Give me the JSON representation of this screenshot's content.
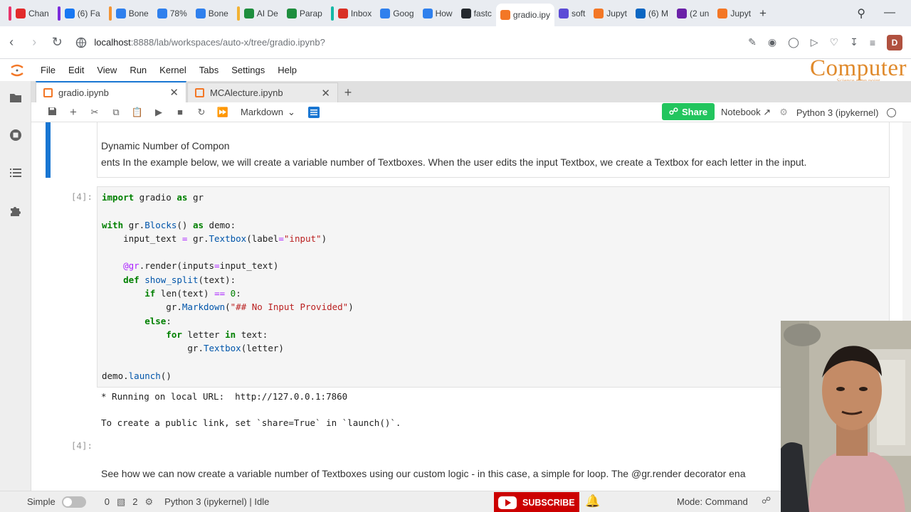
{
  "browser": {
    "tabs": [
      {
        "label": "Chan",
        "color": "#e22b2b",
        "group": "#e8336b"
      },
      {
        "label": "(6) Fa",
        "color": "#1877f2",
        "group": "#7b2cdb"
      },
      {
        "label": "Bone",
        "color": "#2f80ed",
        "group": "#f29433"
      },
      {
        "label": "78%",
        "color": "#2f80ed"
      },
      {
        "label": "Bone",
        "color": "#2f80ed"
      },
      {
        "label": "AI De",
        "color": "#1e8e3e",
        "group": "#f2b233"
      },
      {
        "label": "Parap",
        "color": "#1e8e3e"
      },
      {
        "label": "Inbox",
        "color": "#d93025",
        "group": "#14b8a6"
      },
      {
        "label": "Goog",
        "color": "#2f80ed"
      },
      {
        "label": "How",
        "color": "#2f80ed"
      },
      {
        "label": "fastc",
        "color": "#24292e"
      },
      {
        "label": "gradio.ipy",
        "color": "#f37726",
        "active": true
      },
      {
        "label": "soft",
        "color": "#5b4bd6"
      },
      {
        "label": "Jupyt",
        "color": "#f37726"
      },
      {
        "label": "(6) M",
        "color": "#0a66c2"
      },
      {
        "label": "(2 un",
        "color": "#6b21a8"
      },
      {
        "label": "Jupyt",
        "color": "#f37726"
      }
    ],
    "new_tab": "+",
    "url_host": "localhost",
    "url_path": ":8888/lab/workspaces/auto-x/tree/gradio.ipynb?",
    "profile_initial": "D"
  },
  "watermark": {
    "title": "Computer",
    "subtitle": "Science gyan point"
  },
  "menu": [
    "File",
    "Edit",
    "View",
    "Run",
    "Kernel",
    "Tabs",
    "Settings",
    "Help"
  ],
  "notebook_tabs": [
    {
      "label": "gradio.ipynb",
      "active": true
    },
    {
      "label": "MCAlecture.ipynb",
      "active": false
    }
  ],
  "toolbar": {
    "cell_type": "Markdown",
    "share": "Share",
    "notebook": "Notebook",
    "kernel": "Python 3 (ipykernel)"
  },
  "cells": {
    "md1_line1": "Dynamic Number of Compon",
    "md1_line2": "ents In the example below, we will create a variable number of Textboxes. When the user edits the input Textbox, we create a Textbox for each letter in the input.",
    "code_prompt": "[4]:",
    "output_line1": "* Running on local URL:  http://127.0.0.1:7860",
    "output_line2": "To create a public link, set `share=True` in `launch()`.",
    "out_prompt": "[4]:",
    "md2": "See how we can now create a variable number of Textboxes using our custom logic - in this case, a simple for loop. The @gr.render decorator ena"
  },
  "status": {
    "mode_label": "Simple",
    "count1": "0",
    "count2": "2",
    "kernel": "Python 3 (ipykernel) | Idle",
    "subscribe": "SUBSCRIBE",
    "mode": "Mode: Command"
  },
  "colors": {
    "accent": "#1976d2",
    "share": "#22c55e",
    "jupyter_orange": "#f37726",
    "subscribe": "#cc0000"
  }
}
